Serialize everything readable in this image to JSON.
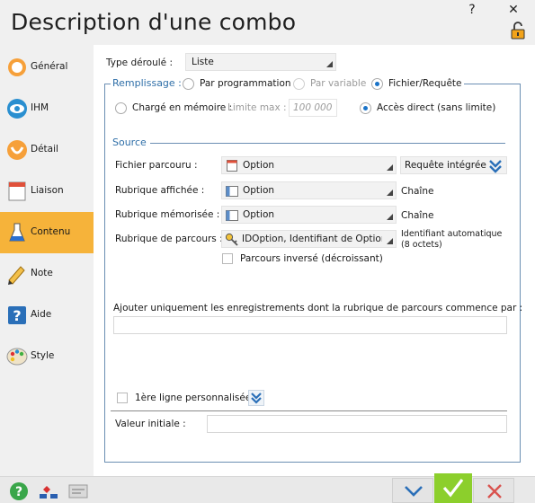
{
  "window": {
    "title": "Description d'une combo",
    "help_glyph": "?",
    "close_glyph": "✕"
  },
  "sidebar": {
    "items": [
      {
        "label": "Général",
        "icon": "circle-icon"
      },
      {
        "label": "IHM",
        "icon": "eye-icon"
      },
      {
        "label": "Détail",
        "icon": "shield-icon"
      },
      {
        "label": "Liaison",
        "icon": "calendar-icon"
      },
      {
        "label": "Contenu",
        "icon": "flask-icon",
        "active": true
      },
      {
        "label": "Note",
        "icon": "pencil-icon"
      },
      {
        "label": "Aide",
        "icon": "help-icon"
      },
      {
        "label": "Style",
        "icon": "palette-icon"
      }
    ],
    "active_color": "#f6b33a"
  },
  "form": {
    "type_deroule_label": "Type déroulé :",
    "type_deroule_value": "Liste",
    "remplissage_label": "Remplissage :",
    "radio_programmation": "Par programmation",
    "radio_variable": "Par variable",
    "radio_fichier": "Fichier/Requête",
    "radio_memoire": "Chargé en mémoire :",
    "limite_label": "Limite max :",
    "limite_value": "100 000",
    "radio_acces_direct": "Accès direct (sans limite)",
    "source_header": "Source",
    "fichier_parcouru_label": "Fichier parcouru :",
    "fichier_parcouru_value": "Option",
    "requete_integree": "Requête intégrée",
    "rubrique_affichee_label": "Rubrique affichée :",
    "rubrique_affichee_value": "Option",
    "rubrique_affichee_type": "Chaîne",
    "rubrique_memorisee_label": "Rubrique mémorisée :",
    "rubrique_memorisee_value": "Option",
    "rubrique_memorisee_type": "Chaîne",
    "rubrique_parcours_label": "Rubrique de parcours :",
    "rubrique_parcours_value": "IDOption, Identifiant de Optior",
    "rubrique_parcours_type_line1": "Identifiant automatique",
    "rubrique_parcours_type_line2": "(8 octets)",
    "parcours_inverse": "Parcours inversé (décroissant)",
    "filtre_label": "Ajouter uniquement les enregistrements dont la rubrique de parcours commence par :",
    "filtre_value": "",
    "premiere_ligne": "1ère ligne personnalisée",
    "valeur_initiale_label": "Valeur initiale :",
    "valeur_initiale_value": ""
  },
  "colors": {
    "accent_blue": "#2f6fa8",
    "ok_green": "#8ccf2c",
    "cancel_red": "#d9534f"
  }
}
